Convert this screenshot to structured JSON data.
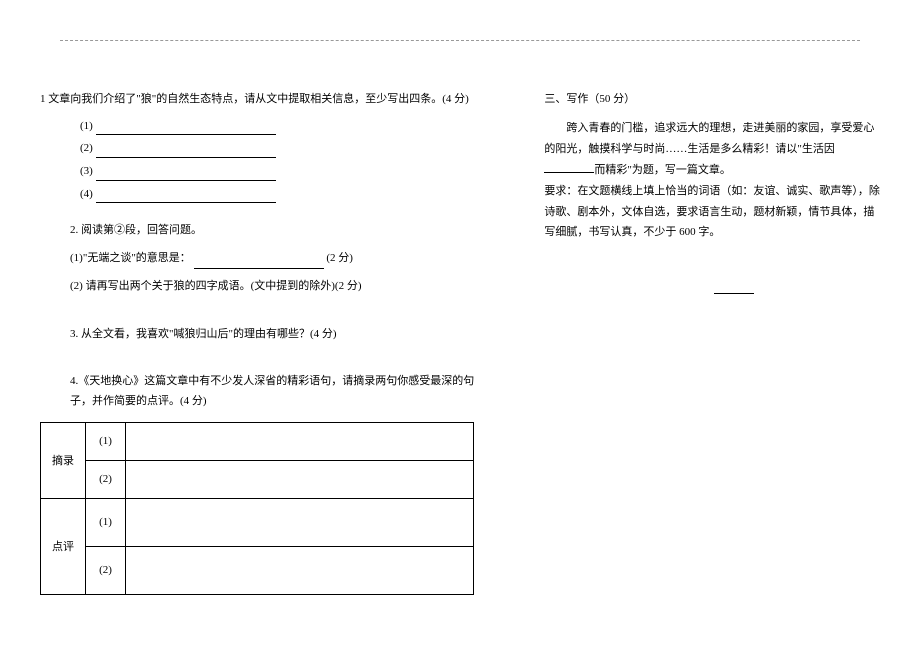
{
  "left": {
    "q1": {
      "text": "1 文章向我们介绍了\"狼\"的自然生态特点，请从文中提取相关信息，至少写出四条。(4 分)",
      "items": [
        "(1)",
        "(2)",
        "(3)",
        "(4)"
      ]
    },
    "q2": {
      "title": "2. 阅读第②段，回答问题。",
      "sub1_prefix": "(1)\"无端之谈\"的意思是：",
      "sub1_score": "(2 分)",
      "sub2": "(2) 请再写出两个关于狼的四字成语。(文中提到的除外)(2 分)"
    },
    "q3": {
      "text": "3. 从全文看，我喜欢\"喊狼归山后\"的理由有哪些？(4 分)"
    },
    "q4": {
      "text": "4.《天地换心》这篇文章中有不少发人深省的精彩语句，请摘录两句你感受最深的句子，并作简要的点评。(4 分)",
      "row_labels": [
        "摘录",
        "点评"
      ],
      "nums": [
        "(1)",
        "(2)"
      ]
    }
  },
  "right": {
    "title": "三、写作（50 分）",
    "para1": "跨入青春的门槛，追求远大的理想，走进美丽的家园，享受爱心的阳光，触摸科学与时尚……生活是多么精彩！请以\"生活因",
    "para1_suffix": "而精彩\"为题，写一篇文章。",
    "para2": "要求：在文题横线上填上恰当的词语（如：友谊、诚实、歌声等），除诗歌、剧本外，文体自选，要求语言生动，题材新颖，情节具体，描写细腻，书写认真，不少于 600 字。"
  }
}
